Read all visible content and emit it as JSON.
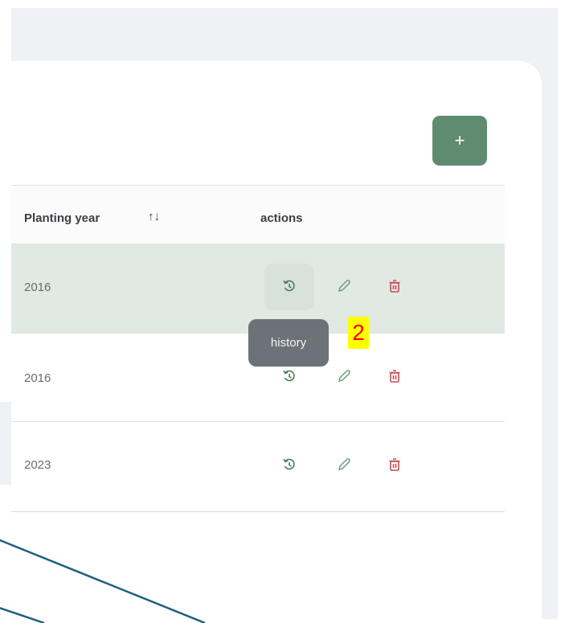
{
  "toolbar": {
    "add_label": "+"
  },
  "table": {
    "headers": {
      "planting_year": "Planting year",
      "sort_icon": "↑↓",
      "actions": "actions"
    },
    "rows": [
      {
        "planting_year": "2016",
        "selected": true
      },
      {
        "planting_year": "2016",
        "selected": false
      },
      {
        "planting_year": "2023",
        "selected": false
      }
    ]
  },
  "tooltip": {
    "text": "history"
  },
  "annotation": {
    "label": "2"
  },
  "colors": {
    "accent": "#5f8b6f",
    "history_icon": "#4f7c5e",
    "edit_icon": "#6f9b7f",
    "delete_icon": "#c44c55",
    "selected_row": "#e1e9e3",
    "tooltip_bg": "#6c7277",
    "overlay_line": "#1f5f7f"
  },
  "icons": {
    "history": "history-icon",
    "edit": "pencil-icon",
    "delete": "trash-icon",
    "add": "plus-icon"
  }
}
